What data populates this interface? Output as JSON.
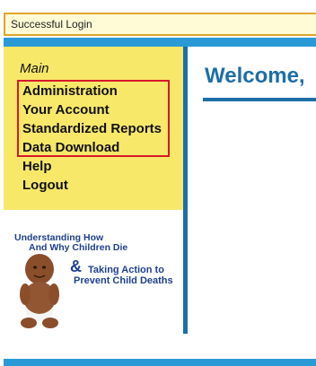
{
  "status": {
    "message": "Successful Login"
  },
  "sidebar": {
    "heading": "Main",
    "items": [
      {
        "label": "Administration"
      },
      {
        "label": "Your Account"
      },
      {
        "label": "Standardized Reports"
      },
      {
        "label": "Data Download"
      },
      {
        "label": "Help"
      },
      {
        "label": "Logout"
      }
    ]
  },
  "main": {
    "welcome": "Welcome,"
  },
  "promo": {
    "line1": "Understanding How",
    "line2": "And Why Children Die",
    "ampersand": "&",
    "line3": "Taking Action to",
    "line4": "Prevent Child Deaths",
    "image": "baby-icon"
  },
  "colors": {
    "accent_blue": "#2a9ad6",
    "title_blue": "#1c6fa8",
    "sidebar_yellow": "#f7e86a",
    "highlight_red": "#d8182a",
    "status_bg": "#fffbd6",
    "status_border": "#e0a52e"
  }
}
